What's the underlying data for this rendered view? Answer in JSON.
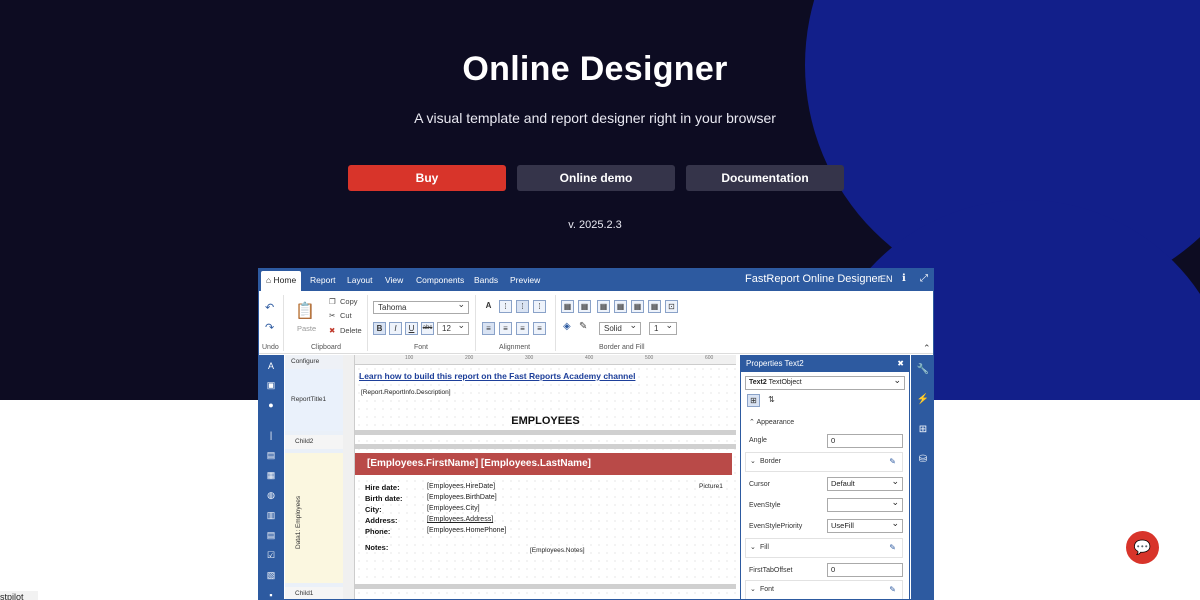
{
  "hero": {
    "title": "Online Designer",
    "subtitle": "A visual template and report designer right in your browser",
    "buttons": {
      "buy": "Buy",
      "demo": "Online demo",
      "docs": "Documentation"
    },
    "version": "v. 2025.2.3",
    "colors": {
      "background": "#0d0c22",
      "circle": "#121f8a",
      "buy": "#d8342a",
      "secondary": "#35344a"
    }
  },
  "designer": {
    "tabs": [
      "Home",
      "Report",
      "Layout",
      "View",
      "Components",
      "Bands",
      "Preview"
    ],
    "brand": "FastReport Online Designer",
    "lang": "EN",
    "ribbon": {
      "undo": "Undo",
      "clipboard": {
        "paste": "Paste",
        "copy": "Copy",
        "cut": "Cut",
        "delete": "Delete",
        "label": "Clipboard"
      },
      "font": {
        "family": "Tahoma",
        "size": "12",
        "label": "Font",
        "bold": "B",
        "italic": "I",
        "underline": "U",
        "strike": "abc"
      },
      "alignment_label": "Alignment",
      "border": {
        "style": "Solid",
        "width": "1",
        "label": "Border and Fill"
      }
    },
    "bands": {
      "configure": "Configure bands...",
      "report_title": "ReportTitle1",
      "child2": "Child2",
      "data": "Data1: Employees",
      "child1": "Child1"
    },
    "ruler": [
      "100",
      "200",
      "300",
      "400",
      "500",
      "600"
    ],
    "canvas": {
      "link": "Learn how to build this report on the Fast Reports Academy channel",
      "description": "[Report.ReportInfo.Description]",
      "title": "EMPLOYEES",
      "name": "[Employees.FirstName] [Employees.LastName]",
      "labels": [
        "Hire date:",
        "Birth date:",
        "City:",
        "Address:",
        "Phone:",
        "Notes:"
      ],
      "fields": [
        "[Employees.HireDate]",
        "[Employees.BirthDate]",
        "[Employees.City]",
        "[Employees.Address]",
        "[Employees.HomePhone]"
      ],
      "notes": "[Employees.Notes]",
      "picture": "Picture1"
    },
    "properties": {
      "header": "Properties Text2",
      "object": "Text2",
      "object_type": "TextObject",
      "appearance": "Appearance",
      "angle_label": "Angle",
      "angle": "0",
      "border": "Border",
      "cursor_label": "Cursor",
      "cursor": "Default",
      "evenstyle_label": "EvenStyle",
      "evenstyle": "",
      "evenstylepriority_label": "EvenStylePriority",
      "evenstylepriority": "UseFill",
      "fill": "Fill",
      "firsttaboffset_label": "FirstTabOffset",
      "firsttaboffset": "0",
      "font": "Font"
    }
  },
  "trustpilot": "stpilot",
  "icons": [
    "home-icon",
    "info-icon",
    "expand-icon",
    "undo-icon",
    "redo-icon",
    "paste-icon",
    "copy-icon",
    "cut-icon",
    "delete-icon",
    "chat-icon",
    "wrench-icon",
    "lightning-icon",
    "tree-icon",
    "database-icon"
  ]
}
